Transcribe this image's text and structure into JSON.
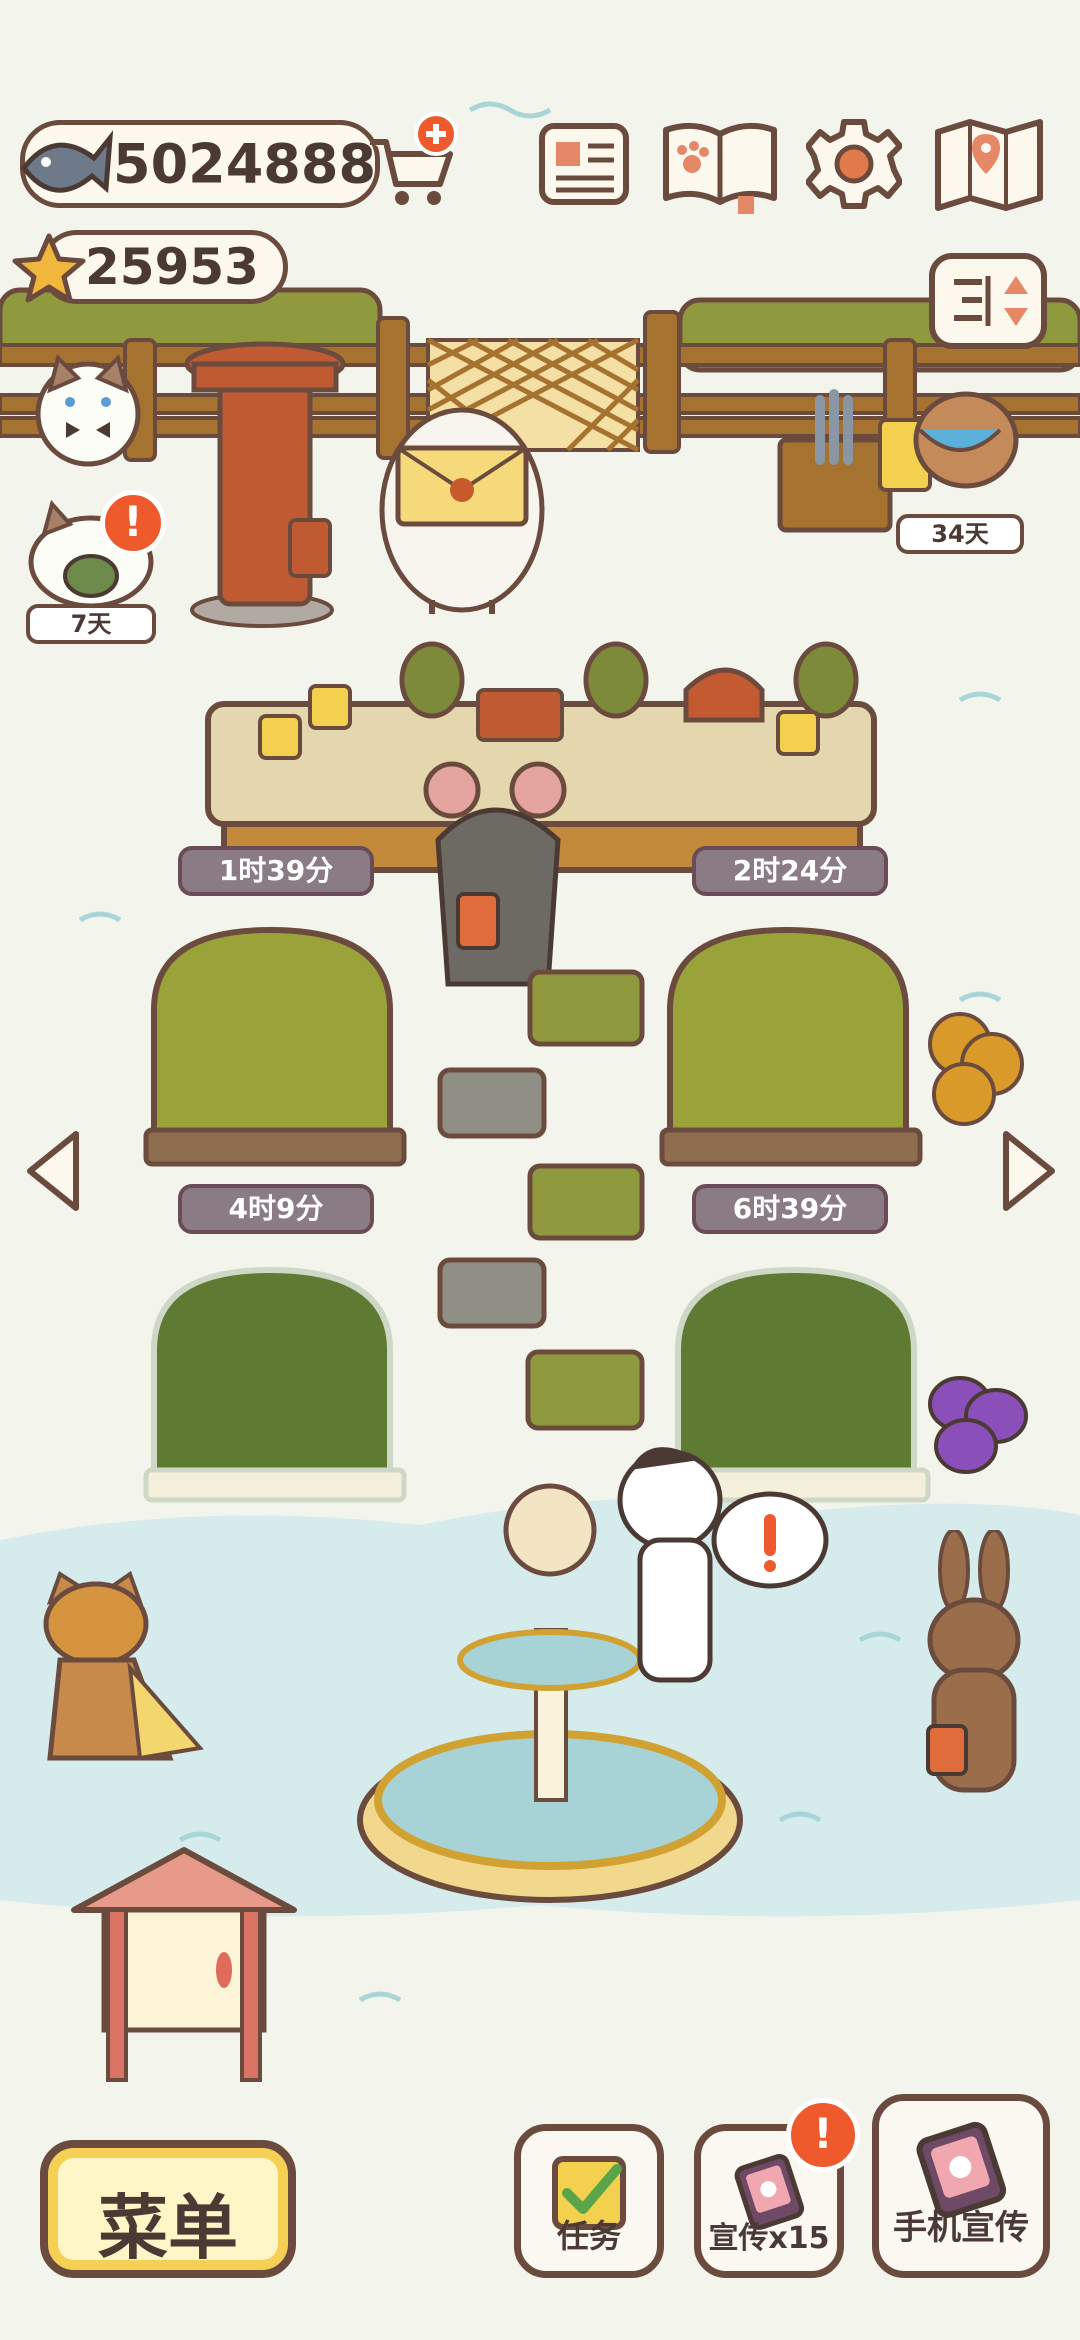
{
  "hud": {
    "fish_currency": "5024888",
    "star_currency": "25953"
  },
  "icons": {
    "fish": "fish-icon",
    "star": "star-icon",
    "shop_add": "shop-cart-add-icon",
    "newspaper": "newspaper-icon",
    "pawbook": "paw-book-icon",
    "settings": "gear-icon",
    "map": "map-icon",
    "reorder": "reorder-toggle-icon"
  },
  "visitors": {
    "cat_frog_days": "7天",
    "deer_days": "34天"
  },
  "timers": {
    "counter_left": "1时39分",
    "counter_right": "2时24分",
    "greenhouse_left": "4时9分",
    "greenhouse_right": "6时39分"
  },
  "buttons": {
    "menu": "菜单",
    "tasks": "任务",
    "promo": "宣传x15",
    "phone_promo": "手机宣传"
  },
  "badges": {
    "alert": "!"
  },
  "colors": {
    "outline": "#6b4b3e",
    "grass": "#8a9a3a",
    "water": "#d6ecec",
    "alert": "#ee5a2b"
  }
}
